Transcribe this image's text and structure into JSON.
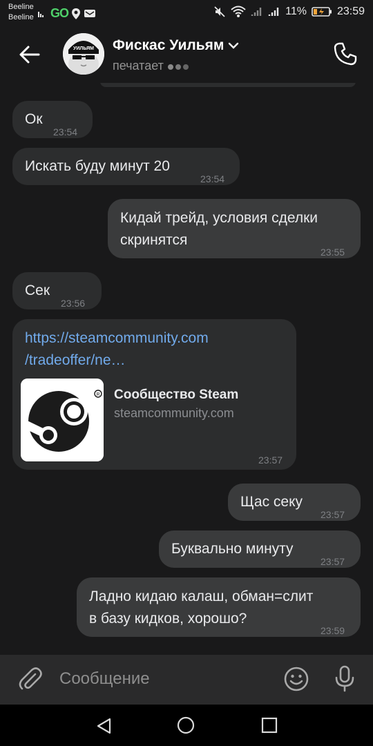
{
  "status_bar": {
    "operator_1": "Beeline",
    "operator_2": "Beeline",
    "go_label": "GO",
    "battery": "11%",
    "time": "23:59"
  },
  "header": {
    "contact_name": "Фискас Уильям",
    "avatar_text": "УИЛЬЯМ",
    "status": "печатает"
  },
  "messages": [
    {
      "dir": "in",
      "text": "Ок",
      "time": "23:54"
    },
    {
      "dir": "in",
      "text": "Искать буду минут 20",
      "time": "23:54"
    },
    {
      "dir": "out",
      "text_line1": "Кидай трейд, условия сделки",
      "text_line2": "скринятся",
      "time": "23:55"
    },
    {
      "dir": "in",
      "text": "Сек",
      "time": "23:56"
    },
    {
      "dir": "in",
      "type": "link",
      "link_line1": "https://steamcommunity.com",
      "link_line2": "/tradeoffer/ne…",
      "card_title": "Сообщество Steam",
      "card_domain": "steamcommunity.com",
      "time": "23:57"
    },
    {
      "dir": "out",
      "text": "Щас секу",
      "time": "23:57"
    },
    {
      "dir": "out",
      "text": "Буквально минуту",
      "time": "23:57"
    },
    {
      "dir": "out",
      "text_line1": "Ладно кидаю калаш, обман=слит",
      "text_line2": "в базу кидков, хорошо?",
      "time": "23:59"
    }
  ],
  "composer": {
    "placeholder": "Сообщение"
  },
  "colors": {
    "background": "#19191a",
    "incoming_bubble": "#2c2d2e",
    "outgoing_bubble": "#3a3b3c",
    "link": "#71aaeb"
  },
  "icons": [
    "back-arrow-icon",
    "chevron-down-icon",
    "phone-icon",
    "paperclip-icon",
    "emoji-icon",
    "microphone-icon",
    "nav-back-icon",
    "nav-home-icon",
    "nav-recent-icon"
  ]
}
